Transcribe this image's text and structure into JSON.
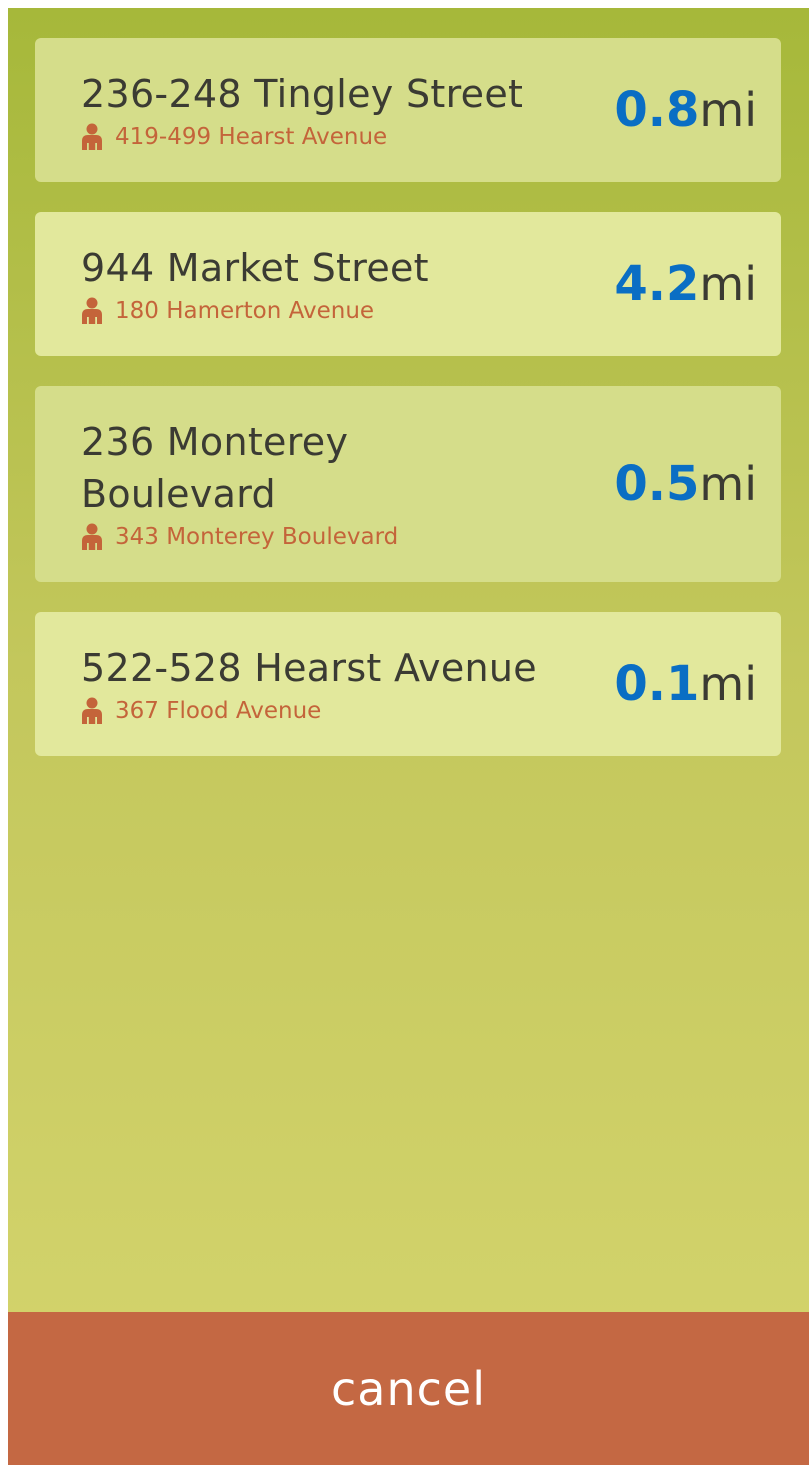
{
  "colors": {
    "background_top": "#a6b83a",
    "background_bottom": "#d5d56e",
    "card_a": "#d5dd8a",
    "card_b": "#e2e89c",
    "distance_number": "#0a6ec4",
    "subtitle_text": "#c4643a",
    "cancel_background": "#c46843"
  },
  "results": [
    {
      "title": "236-248 Tingley Street",
      "subtitle": "419-499 Hearst Avenue",
      "distance": "0.8",
      "unit": "mi",
      "icon": "person-icon"
    },
    {
      "title": "944 Market Street",
      "subtitle": "180 Hamerton Avenue",
      "distance": "4.2",
      "unit": "mi",
      "icon": "person-icon"
    },
    {
      "title": "236 Monterey Boulevard",
      "subtitle": "343 Monterey Boulevard",
      "distance": "0.5",
      "unit": "mi",
      "icon": "person-icon"
    },
    {
      "title": "522-528 Hearst Avenue",
      "subtitle": "367 Flood Avenue",
      "distance": "0.1",
      "unit": "mi",
      "icon": "person-icon"
    }
  ],
  "cancel_label": "cancel"
}
